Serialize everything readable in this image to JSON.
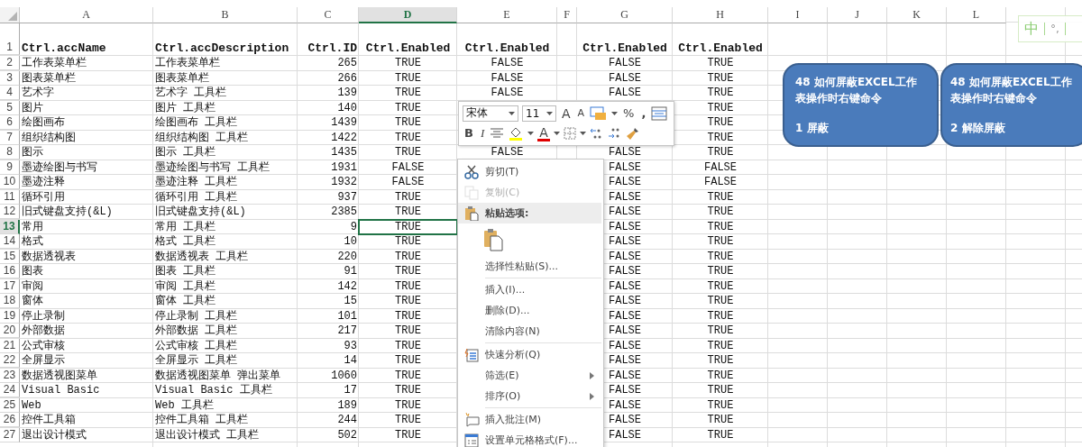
{
  "columns": [
    {
      "label": "A",
      "selected": false
    },
    {
      "label": "B",
      "selected": false
    },
    {
      "label": "C",
      "selected": false
    },
    {
      "label": "D",
      "selected": true
    },
    {
      "label": "E",
      "selected": false
    },
    {
      "label": "F",
      "selected": false
    },
    {
      "label": "G",
      "selected": false
    },
    {
      "label": "H",
      "selected": false
    },
    {
      "label": "I",
      "selected": false
    },
    {
      "label": "J",
      "selected": false
    },
    {
      "label": "K",
      "selected": false
    },
    {
      "label": "L",
      "selected": false
    }
  ],
  "header_row": {
    "number": "1",
    "cells": [
      "Ctrl.accName",
      "Ctrl.accDescription",
      "Ctrl.ID",
      "Ctrl.Enabled",
      "Ctrl.Enabled",
      null,
      "Ctrl.Enabled",
      "Ctrl.Enabled"
    ]
  },
  "rows": [
    {
      "number": "2",
      "selected": false,
      "cells": [
        "工作表菜单栏",
        "工作表菜单栏",
        "265",
        "TRUE",
        "FALSE",
        null,
        "FALSE",
        "TRUE"
      ]
    },
    {
      "number": "3",
      "selected": false,
      "cells": [
        "图表菜单栏",
        "图表菜单栏",
        "266",
        "TRUE",
        "FALSE",
        null,
        "FALSE",
        "TRUE"
      ]
    },
    {
      "number": "4",
      "selected": false,
      "cells": [
        "艺术字",
        "艺术字 工具栏",
        "139",
        "TRUE",
        "FALSE",
        null,
        "FALSE",
        "TRUE"
      ]
    },
    {
      "number": "5",
      "selected": false,
      "cells": [
        "图片",
        "图片 工具栏",
        "140",
        "TRUE",
        null,
        null,
        null,
        "TRUE"
      ]
    },
    {
      "number": "6",
      "selected": false,
      "cells": [
        "绘图画布",
        "绘图画布 工具栏",
        "1439",
        "TRUE",
        null,
        null,
        null,
        "TRUE"
      ]
    },
    {
      "number": "7",
      "selected": false,
      "cells": [
        "组织结构图",
        "组织结构图 工具栏",
        "1422",
        "TRUE",
        null,
        null,
        null,
        "TRUE"
      ]
    },
    {
      "number": "8",
      "selected": false,
      "cells": [
        "图示",
        "图示 工具栏",
        "1435",
        "TRUE",
        "FALSE",
        null,
        "FALSE",
        "TRUE"
      ]
    },
    {
      "number": "9",
      "selected": false,
      "cells": [
        "墨迹绘图与书写",
        "墨迹绘图与书写 工具栏",
        "1931",
        "FALSE",
        null,
        null,
        "FALSE",
        "FALSE"
      ]
    },
    {
      "number": "10",
      "selected": false,
      "cells": [
        "墨迹注释",
        "墨迹注释 工具栏",
        "1932",
        "FALSE",
        null,
        null,
        "FALSE",
        "FALSE"
      ]
    },
    {
      "number": "11",
      "selected": false,
      "cells": [
        "循环引用",
        "循环引用 工具栏",
        "937",
        "TRUE",
        null,
        null,
        "FALSE",
        "TRUE"
      ]
    },
    {
      "number": "12",
      "selected": false,
      "cells": [
        "旧式键盘支持(&L)",
        "旧式键盘支持(&L)",
        "2385",
        "TRUE",
        null,
        null,
        "FALSE",
        "TRUE"
      ]
    },
    {
      "number": "13",
      "selected": true,
      "cells": [
        "常用",
        "常用 工具栏",
        "9",
        "TRUE",
        null,
        null,
        "FALSE",
        "TRUE"
      ]
    },
    {
      "number": "14",
      "selected": false,
      "cells": [
        "格式",
        "格式 工具栏",
        "10",
        "TRUE",
        null,
        null,
        "FALSE",
        "TRUE"
      ]
    },
    {
      "number": "15",
      "selected": false,
      "cells": [
        "数据透视表",
        "数据透视表 工具栏",
        "220",
        "TRUE",
        null,
        null,
        "FALSE",
        "TRUE"
      ]
    },
    {
      "number": "16",
      "selected": false,
      "cells": [
        "图表",
        "图表 工具栏",
        "91",
        "TRUE",
        null,
        null,
        "FALSE",
        "TRUE"
      ]
    },
    {
      "number": "17",
      "selected": false,
      "cells": [
        "审阅",
        "审阅 工具栏",
        "142",
        "TRUE",
        null,
        null,
        "FALSE",
        "TRUE"
      ]
    },
    {
      "number": "18",
      "selected": false,
      "cells": [
        "窗体",
        "窗体 工具栏",
        "15",
        "TRUE",
        null,
        null,
        "FALSE",
        "TRUE"
      ]
    },
    {
      "number": "19",
      "selected": false,
      "cells": [
        "停止录制",
        "停止录制 工具栏",
        "101",
        "TRUE",
        null,
        null,
        "FALSE",
        "TRUE"
      ]
    },
    {
      "number": "20",
      "selected": false,
      "cells": [
        "外部数据",
        "外部数据 工具栏",
        "217",
        "TRUE",
        null,
        null,
        "FALSE",
        "TRUE"
      ]
    },
    {
      "number": "21",
      "selected": false,
      "cells": [
        "公式审核",
        "公式审核 工具栏",
        "93",
        "TRUE",
        null,
        null,
        "FALSE",
        "TRUE"
      ]
    },
    {
      "number": "22",
      "selected": false,
      "cells": [
        "全屏显示",
        "全屏显示 工具栏",
        "14",
        "TRUE",
        null,
        null,
        "FALSE",
        "TRUE"
      ]
    },
    {
      "number": "23",
      "selected": false,
      "cells": [
        "数据透视图菜单",
        "数据透视图菜单 弹出菜单",
        "1060",
        "TRUE",
        null,
        null,
        "FALSE",
        "TRUE"
      ]
    },
    {
      "number": "24",
      "selected": false,
      "cells": [
        "Visual Basic",
        "Visual Basic 工具栏",
        "17",
        "TRUE",
        null,
        null,
        "FALSE",
        "TRUE"
      ]
    },
    {
      "number": "25",
      "selected": false,
      "cells": [
        "Web",
        "Web 工具栏",
        "189",
        "TRUE",
        null,
        null,
        "FALSE",
        "TRUE"
      ]
    },
    {
      "number": "26",
      "selected": false,
      "cells": [
        "控件工具箱",
        "控件工具箱 工具栏",
        "244",
        "TRUE",
        null,
        null,
        "FALSE",
        "TRUE"
      ]
    },
    {
      "number": "27",
      "selected": false,
      "cells": [
        "退出设计模式",
        "退出设计模式 工具栏",
        "502",
        "TRUE",
        null,
        null,
        "FALSE",
        "TRUE"
      ]
    }
  ],
  "mini_toolbar": {
    "font": "宋体",
    "size": "11",
    "grow_label": "A",
    "shrink_label": "A",
    "percent_label": "%",
    "comma_label": ",",
    "bold_label": "B",
    "italic_label": "I",
    "font_color_label": "A"
  },
  "context_menu": [
    {
      "kind": "cut",
      "label": "剪切(T)",
      "disabled": false
    },
    {
      "kind": "copy",
      "label": "复制(C)",
      "disabled": true
    },
    {
      "kind": "heading",
      "label": "粘贴选项:",
      "disabled": false
    },
    {
      "kind": "paste-button"
    },
    {
      "kind": "plain",
      "label": "选择性粘贴(S)...",
      "disabled": false
    },
    {
      "kind": "separator"
    },
    {
      "kind": "plain",
      "label": "插入(I)...",
      "disabled": false
    },
    {
      "kind": "plain",
      "label": "删除(D)...",
      "disabled": false
    },
    {
      "kind": "plain",
      "label": "清除内容(N)",
      "disabled": false
    },
    {
      "kind": "separator"
    },
    {
      "kind": "analysis",
      "label": "快速分析(Q)",
      "disabled": false
    },
    {
      "kind": "submenu",
      "label": "筛选(E)",
      "disabled": false
    },
    {
      "kind": "submenu",
      "label": "排序(O)",
      "disabled": false
    },
    {
      "kind": "separator"
    },
    {
      "kind": "comment",
      "label": "插入批注(M)",
      "disabled": false
    },
    {
      "kind": "format",
      "label": "设置单元格格式(F)...",
      "disabled": false
    }
  ],
  "shapes": [
    {
      "title": "48  如何屏蔽EXCEL工作表操作时右键命令",
      "label": "1 屏蔽"
    },
    {
      "title": "48  如何屏蔽EXCEL工作表操作时右键命令",
      "label": "2 解除屏蔽"
    }
  ],
  "ime": {
    "mode": "中",
    "punctuation": "°,"
  }
}
